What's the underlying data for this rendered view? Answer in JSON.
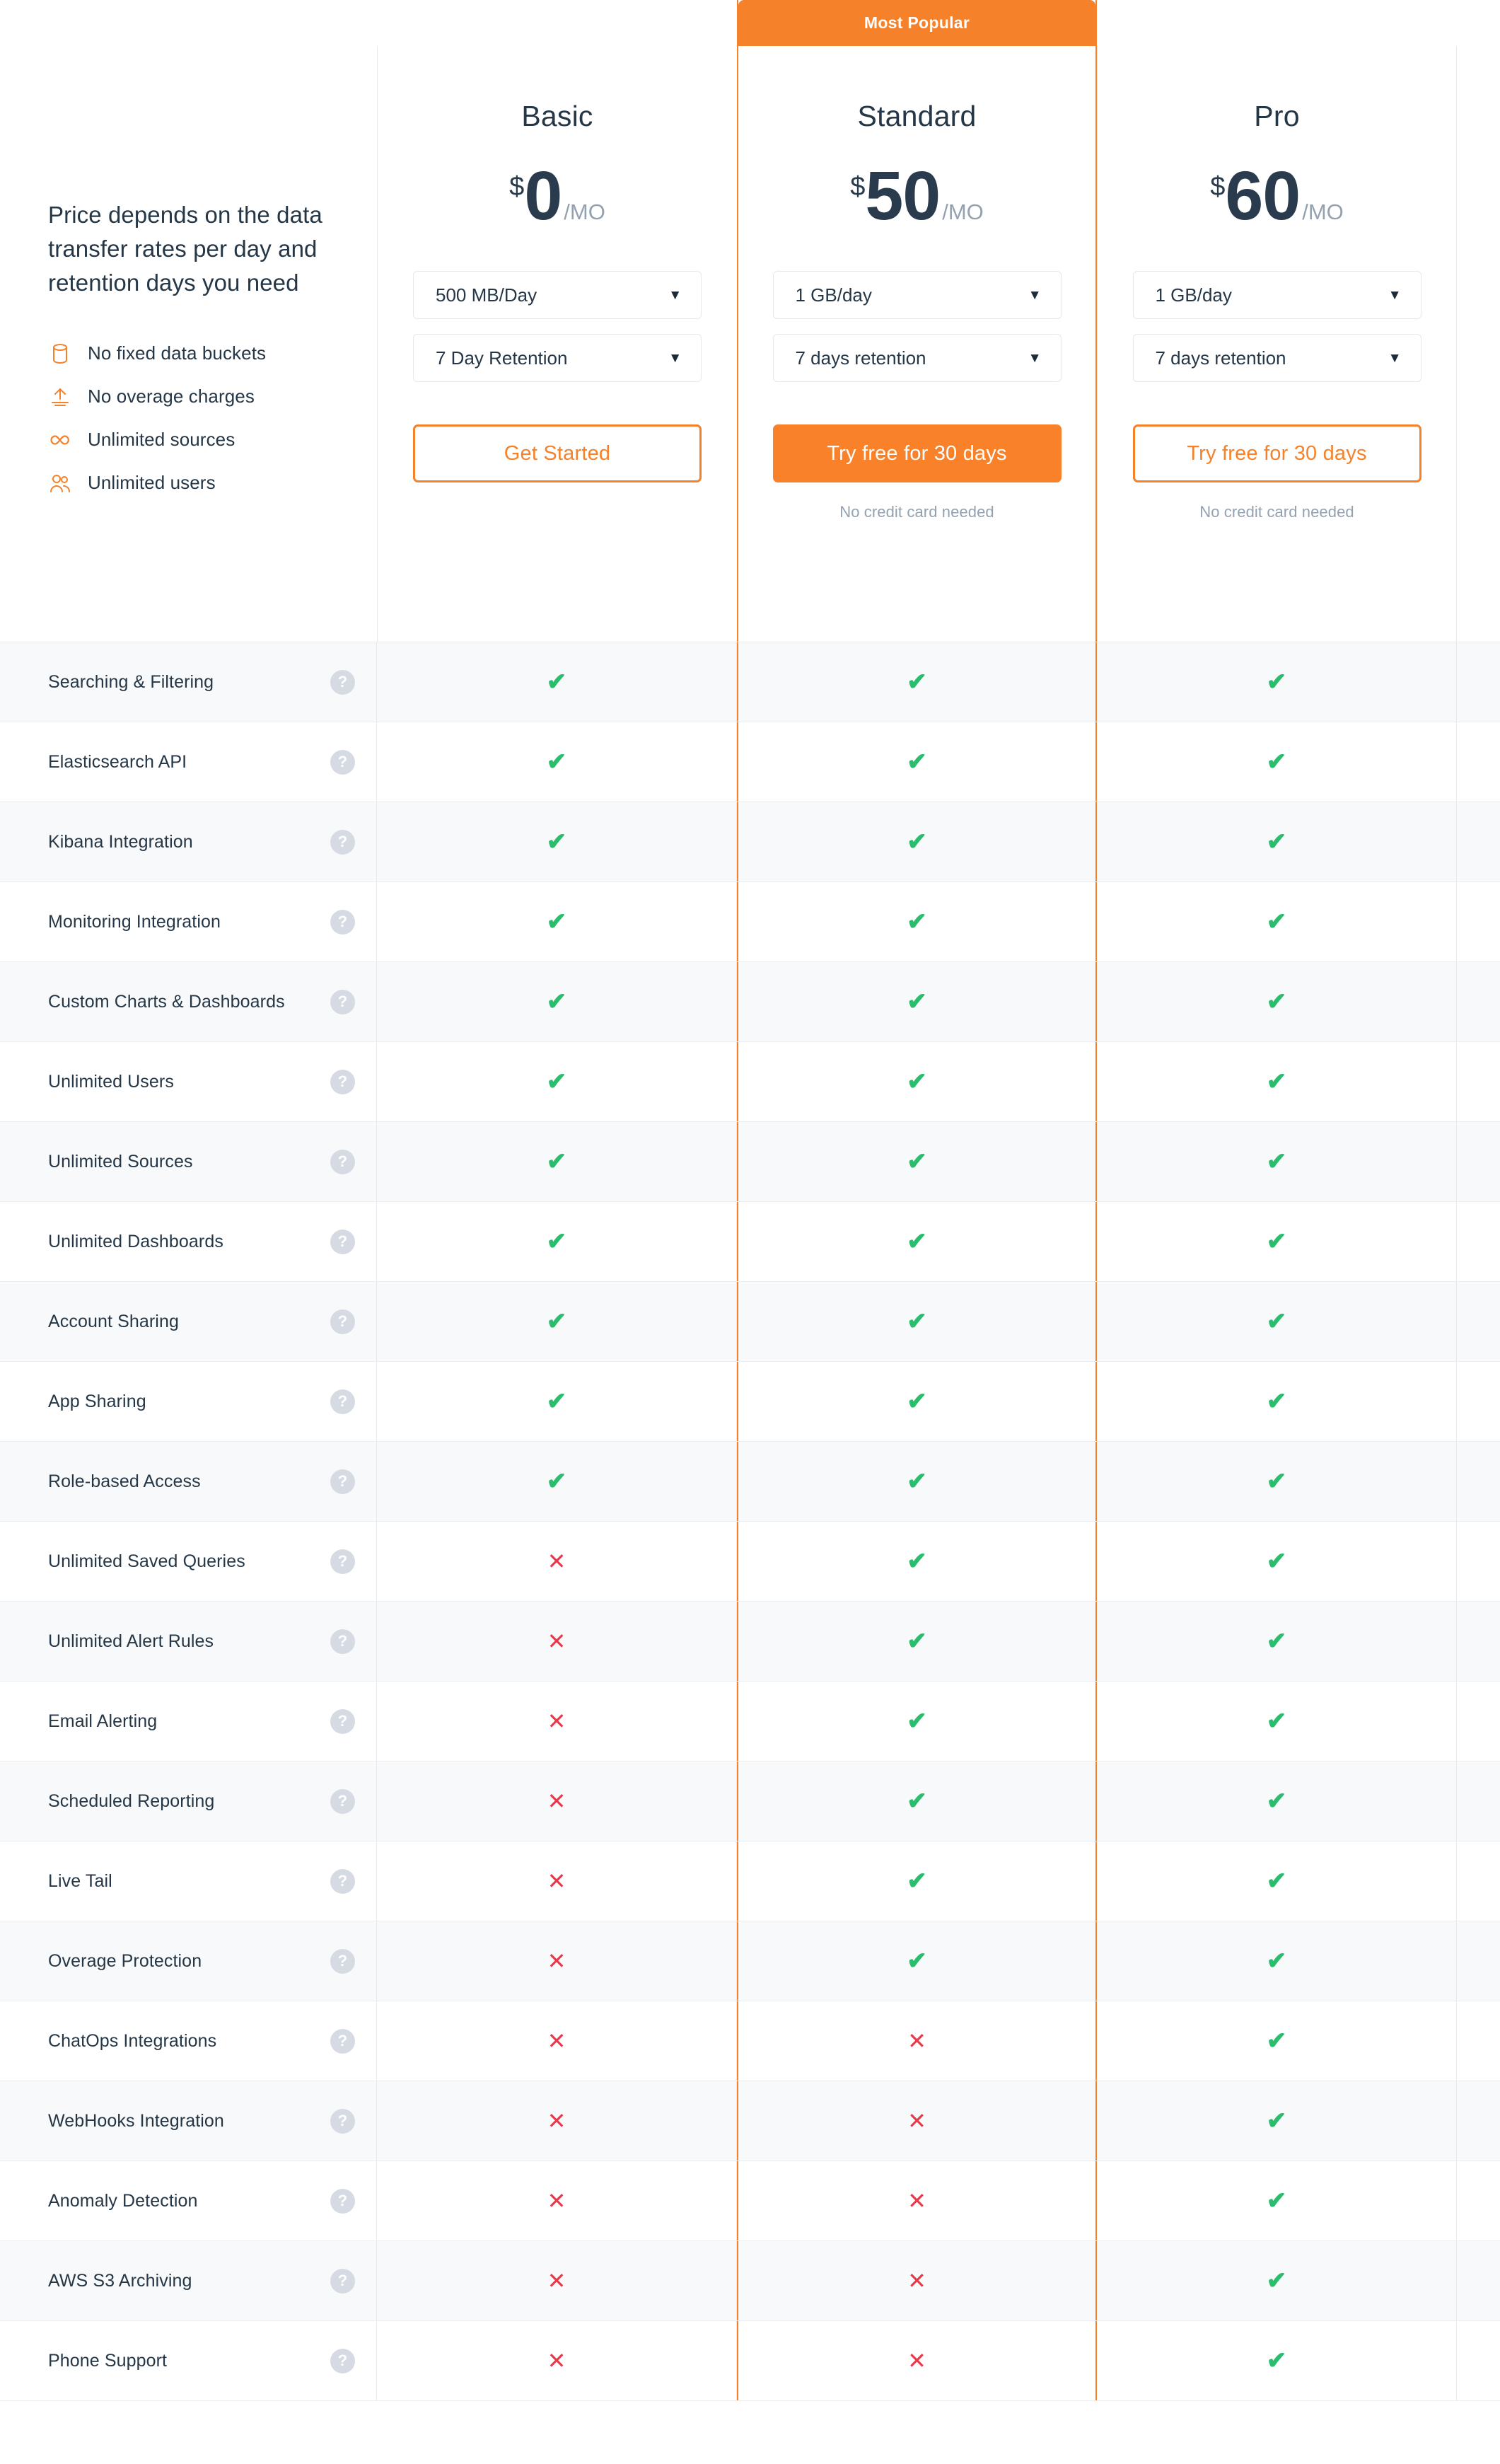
{
  "intro": {
    "headline": "Price depends on the data transfer rates per day and retention days you need",
    "perks": [
      {
        "icon": "database-icon",
        "label": "No fixed data buckets"
      },
      {
        "icon": "upload-icon",
        "label": "No overage charges"
      },
      {
        "icon": "infinity-icon",
        "label": "Unlimited sources"
      },
      {
        "icon": "users-icon",
        "label": "Unlimited users"
      }
    ]
  },
  "colors": {
    "accent_orange": "#f5822a",
    "cta_orange": "#f9812a",
    "dark_navy": "#253746",
    "muted_grey": "#93a1b0",
    "check_green": "#2bbd6e",
    "cross_red": "#e8394b",
    "row_alt": "#f8f9fa",
    "border": "#e8eaed"
  },
  "plans": [
    {
      "id": "basic",
      "ribbon": "",
      "name": "Basic",
      "currency": "$",
      "amount": "0",
      "period": "/MO",
      "data_select": "500 MB/Day",
      "retention_select": "7 Day Retention",
      "caret": "▼",
      "cta_label": "Get Started",
      "cta_style": "outline",
      "cta_note": "",
      "featured": false
    },
    {
      "id": "standard",
      "ribbon": "Most Popular",
      "name": "Standard",
      "currency": "$",
      "amount": "50",
      "period": "/MO",
      "data_select": "1 GB/day",
      "retention_select": "7 days retention",
      "caret": "▼",
      "cta_label": "Try free for 30 days",
      "cta_style": "solid",
      "cta_note": "No credit card needed",
      "featured": true
    },
    {
      "id": "pro",
      "ribbon": "",
      "name": "Pro",
      "currency": "$",
      "amount": "60",
      "period": "/MO",
      "data_select": "1 GB/day",
      "retention_select": "7 days retention",
      "caret": "▼",
      "cta_label": "Try free for 30 days",
      "cta_style": "outline",
      "cta_note": "No credit card needed",
      "featured": false
    }
  ],
  "comparison": {
    "help_glyph": "?",
    "yes_glyph": "✔",
    "no_glyph": "✕",
    "columns": [
      "Basic",
      "Standard",
      "Pro"
    ],
    "rows": [
      {
        "feature": "Searching & Filtering",
        "values": [
          "yes",
          "yes",
          "yes"
        ]
      },
      {
        "feature": "Elasticsearch API",
        "values": [
          "yes",
          "yes",
          "yes"
        ]
      },
      {
        "feature": "Kibana Integration",
        "values": [
          "yes",
          "yes",
          "yes"
        ]
      },
      {
        "feature": "Monitoring Integration",
        "values": [
          "yes",
          "yes",
          "yes"
        ]
      },
      {
        "feature": "Custom Charts & Dashboards",
        "values": [
          "yes",
          "yes",
          "yes"
        ]
      },
      {
        "feature": "Unlimited Users",
        "values": [
          "yes",
          "yes",
          "yes"
        ]
      },
      {
        "feature": "Unlimited Sources",
        "values": [
          "yes",
          "yes",
          "yes"
        ]
      },
      {
        "feature": "Unlimited Dashboards",
        "values": [
          "yes",
          "yes",
          "yes"
        ]
      },
      {
        "feature": "Account Sharing",
        "values": [
          "yes",
          "yes",
          "yes"
        ]
      },
      {
        "feature": "App Sharing",
        "values": [
          "yes",
          "yes",
          "yes"
        ]
      },
      {
        "feature": "Role-based Access",
        "values": [
          "yes",
          "yes",
          "yes"
        ]
      },
      {
        "feature": "Unlimited Saved Queries",
        "values": [
          "no",
          "yes",
          "yes"
        ]
      },
      {
        "feature": "Unlimited Alert Rules",
        "values": [
          "no",
          "yes",
          "yes"
        ]
      },
      {
        "feature": "Email Alerting",
        "values": [
          "no",
          "yes",
          "yes"
        ]
      },
      {
        "feature": "Scheduled Reporting",
        "values": [
          "no",
          "yes",
          "yes"
        ]
      },
      {
        "feature": "Live Tail",
        "values": [
          "no",
          "yes",
          "yes"
        ]
      },
      {
        "feature": "Overage Protection",
        "values": [
          "no",
          "yes",
          "yes"
        ]
      },
      {
        "feature": "ChatOps Integrations",
        "values": [
          "no",
          "no",
          "yes"
        ]
      },
      {
        "feature": "WebHooks Integration",
        "values": [
          "no",
          "no",
          "yes"
        ]
      },
      {
        "feature": "Anomaly Detection",
        "values": [
          "no",
          "no",
          "yes"
        ]
      },
      {
        "feature": "AWS S3 Archiving",
        "values": [
          "no",
          "no",
          "yes"
        ]
      },
      {
        "feature": "Phone Support",
        "values": [
          "no",
          "no",
          "yes"
        ]
      }
    ]
  }
}
